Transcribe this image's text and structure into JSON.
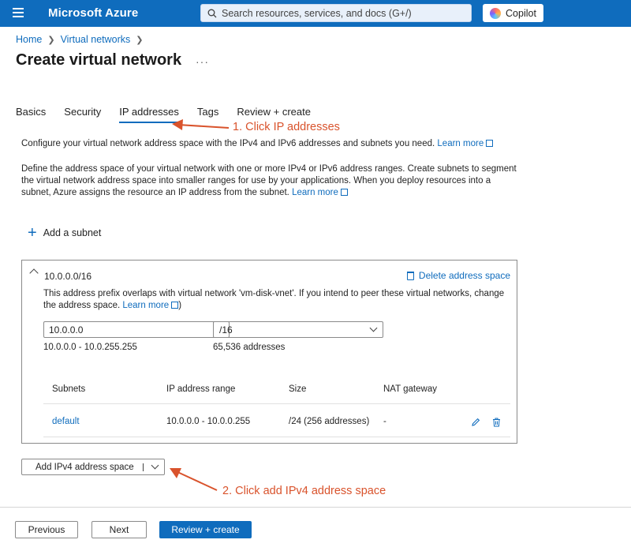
{
  "header": {
    "brand": "Microsoft Azure",
    "search_placeholder": "Search resources, services, and docs (G+/)",
    "copilot_label": "Copilot"
  },
  "breadcrumb": {
    "home": "Home",
    "vnets": "Virtual networks"
  },
  "page": {
    "title": "Create virtual network",
    "more": "···"
  },
  "tabs": [
    {
      "label": "Basics"
    },
    {
      "label": "Security"
    },
    {
      "label": "IP addresses"
    },
    {
      "label": "Tags"
    },
    {
      "label": "Review + create"
    }
  ],
  "annotations": {
    "step1": "1. Click IP addresses",
    "step2": "2. Click add IPv4 address space",
    "color": "#d9532c"
  },
  "description": {
    "line1": "Configure your virtual network address space with the IPv4 and IPv6 addresses and subnets you need.",
    "line1_link": "Learn more",
    "para2": "Define the address space of your virtual network with one or more IPv4 or IPv6 address ranges. Create subnets to segment the virtual network address space into smaller ranges for use by your applications. When you deploy resources into a subnet, Azure assigns the resource an IP address from the subnet.",
    "para2_link": "Learn more"
  },
  "add_subnet_label": "Add a subnet",
  "address_space": {
    "title": "10.0.0.0/16",
    "delete_label": "Delete address space",
    "overlap_text": "This address prefix overlaps with virtual network 'vm-disk-vnet'. If you intend to peer these virtual networks, change the address space.",
    "overlap_link": "Learn more",
    "ip_value": "10.0.0.0",
    "prefix_value": "/16",
    "range": "10.0.0.0 - 10.0.255.255",
    "count": "65,536 addresses",
    "table": {
      "headers": [
        "Subnets",
        "IP address range",
        "Size",
        "NAT gateway"
      ],
      "rows": [
        {
          "name": "default",
          "range": "10.0.0.0 - 10.0.0.255",
          "size": "/24 (256 addresses)",
          "nat": "-"
        }
      ]
    }
  },
  "add_ipv4_label": "Add IPv4 address space",
  "footer": {
    "previous": "Previous",
    "next": "Next",
    "review": "Review + create"
  },
  "colors": {
    "accent": "#0f6cbd"
  }
}
